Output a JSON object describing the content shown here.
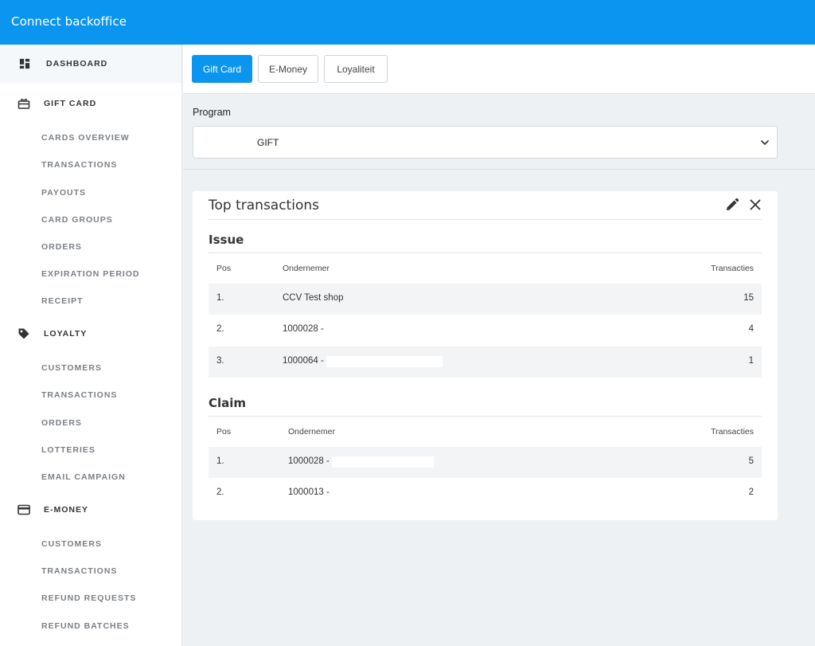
{
  "app": {
    "title": "Connect backoffice"
  },
  "sidebar": {
    "dashboard": "DASHBOARD",
    "gift_card": {
      "label": "GIFT CARD",
      "items": [
        "CARDS OVERVIEW",
        "TRANSACTIONS",
        "PAYOUTS",
        "CARD GROUPS",
        "ORDERS",
        "EXPIRATION PERIOD",
        "RECEIPT"
      ]
    },
    "loyalty": {
      "label": "LOYALTY",
      "items": [
        "CUSTOMERS",
        "TRANSACTIONS",
        "ORDERS",
        "LOTTERIES",
        "EMAIL CAMPAIGN"
      ]
    },
    "emoney": {
      "label": "E-MONEY",
      "items": [
        "CUSTOMERS",
        "TRANSACTIONS",
        "REFUND REQUESTS",
        "REFUND BATCHES"
      ]
    }
  },
  "tabs": [
    {
      "label": "Gift Card",
      "active": true
    },
    {
      "label": "E-Money",
      "active": false
    },
    {
      "label": "Loyaliteit",
      "active": false
    }
  ],
  "program": {
    "label": "Program",
    "value": "GIFT"
  },
  "widget": {
    "title": "Top transactions",
    "issue": {
      "title": "Issue",
      "headers": {
        "pos": "Pos",
        "merchant": "Ondernemer",
        "count": "Transacties"
      },
      "rows": [
        {
          "pos": "1.",
          "merchant": "CCV Test shop",
          "count": "15"
        },
        {
          "pos": "2.",
          "merchant": "1000028 -",
          "count": "4"
        },
        {
          "pos": "3.",
          "merchant": "1000064 -",
          "count": "1"
        }
      ]
    },
    "claim": {
      "title": "Claim",
      "headers": {
        "pos": "Pos",
        "merchant": "Ondernemer",
        "count": "Transacties"
      },
      "rows": [
        {
          "pos": "1.",
          "merchant": "1000028 -",
          "count": "5"
        },
        {
          "pos": "2.",
          "merchant": "1000013 -",
          "count": "2"
        }
      ]
    }
  },
  "colors": {
    "primary": "#0a96f0",
    "background": "#edf1f4"
  }
}
